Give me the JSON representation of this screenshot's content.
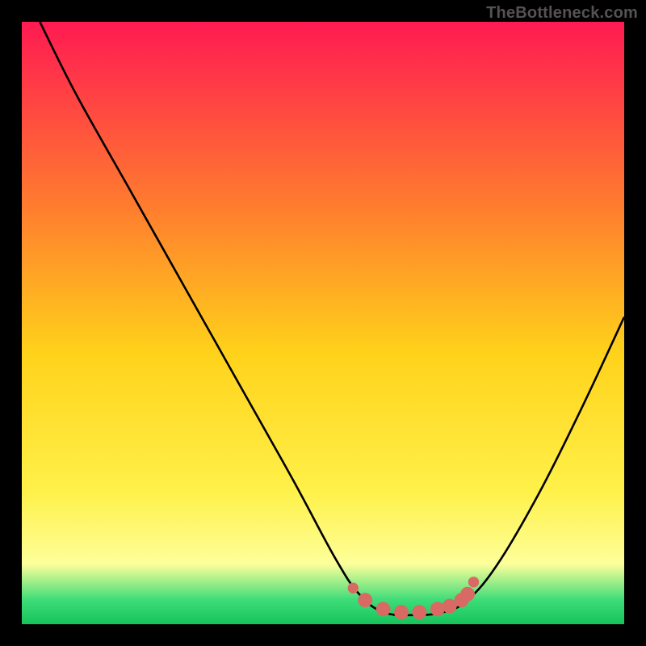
{
  "watermark": "TheBottleneck.com",
  "colors": {
    "frame": "#000000",
    "gradient_top": "#ff1a52",
    "gradient_mid1": "#ff7a2f",
    "gradient_mid2": "#ffd21a",
    "gradient_mid3": "#fff14a",
    "gradient_bot1": "#fdff9a",
    "gradient_bot2": "#3ddc78",
    "gradient_bot3": "#16c45b",
    "curve": "#000000",
    "marker": "#d86a63"
  },
  "chart_data": {
    "type": "line",
    "title": "",
    "xlabel": "",
    "ylabel": "",
    "xlim": [
      0,
      100
    ],
    "ylim": [
      0,
      100
    ],
    "curve": [
      {
        "x": 3,
        "y": 100
      },
      {
        "x": 9,
        "y": 88
      },
      {
        "x": 18,
        "y": 72
      },
      {
        "x": 27,
        "y": 56
      },
      {
        "x": 36,
        "y": 40
      },
      {
        "x": 45,
        "y": 24
      },
      {
        "x": 52,
        "y": 11
      },
      {
        "x": 56,
        "y": 5
      },
      {
        "x": 60,
        "y": 2
      },
      {
        "x": 65,
        "y": 1.5
      },
      {
        "x": 70,
        "y": 2
      },
      {
        "x": 74,
        "y": 4
      },
      {
        "x": 79,
        "y": 10
      },
      {
        "x": 86,
        "y": 22
      },
      {
        "x": 93,
        "y": 36
      },
      {
        "x": 100,
        "y": 51
      }
    ],
    "markers": [
      {
        "x": 55,
        "y": 6
      },
      {
        "x": 57,
        "y": 4
      },
      {
        "x": 60,
        "y": 2.5
      },
      {
        "x": 63,
        "y": 2
      },
      {
        "x": 66,
        "y": 2
      },
      {
        "x": 69,
        "y": 2.5
      },
      {
        "x": 71,
        "y": 3
      },
      {
        "x": 73,
        "y": 4
      },
      {
        "x": 74,
        "y": 5
      },
      {
        "x": 75,
        "y": 7
      }
    ]
  }
}
